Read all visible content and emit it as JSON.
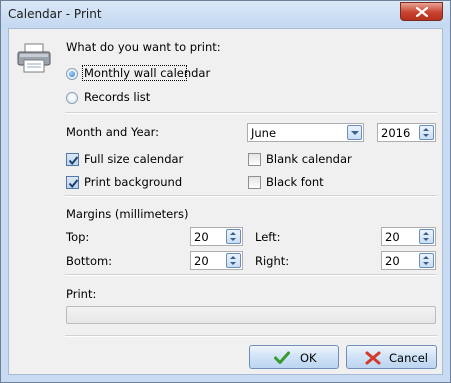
{
  "window": {
    "title": "Calendar - Print"
  },
  "dialog": {
    "question": "What do you want to print:",
    "options": [
      {
        "label": "Monthly wall calendar",
        "selected": true
      },
      {
        "label": "Records list",
        "selected": false
      }
    ],
    "month_year": {
      "label": "Month and Year:",
      "month": "June",
      "year": "2016"
    },
    "checkboxes": [
      {
        "label": "Full size calendar",
        "checked": true
      },
      {
        "label": "Blank calendar",
        "checked": false
      },
      {
        "label": "Print background",
        "checked": true
      },
      {
        "label": "Black font",
        "checked": false
      }
    ],
    "margins": {
      "heading": "Margins (millimeters)",
      "top": {
        "label": "Top:",
        "value": "20"
      },
      "left": {
        "label": "Left:",
        "value": "20"
      },
      "bottom": {
        "label": "Bottom:",
        "value": "20"
      },
      "right": {
        "label": "Right:",
        "value": "20"
      }
    },
    "print": {
      "label": "Print:",
      "progress": 0
    },
    "buttons": {
      "ok": "OK",
      "cancel": "Cancel"
    }
  },
  "icons": {
    "printer": "printer-icon",
    "close": "close-icon",
    "ok": "checkmark-icon",
    "cancel": "cross-icon"
  },
  "colors": {
    "title_bar": "#c7dcf3",
    "client_bg": "#f0f0f0",
    "close_button": "#c7432f",
    "ok_check": "#3a9a2c",
    "cancel_cross": "#d23a2a"
  }
}
